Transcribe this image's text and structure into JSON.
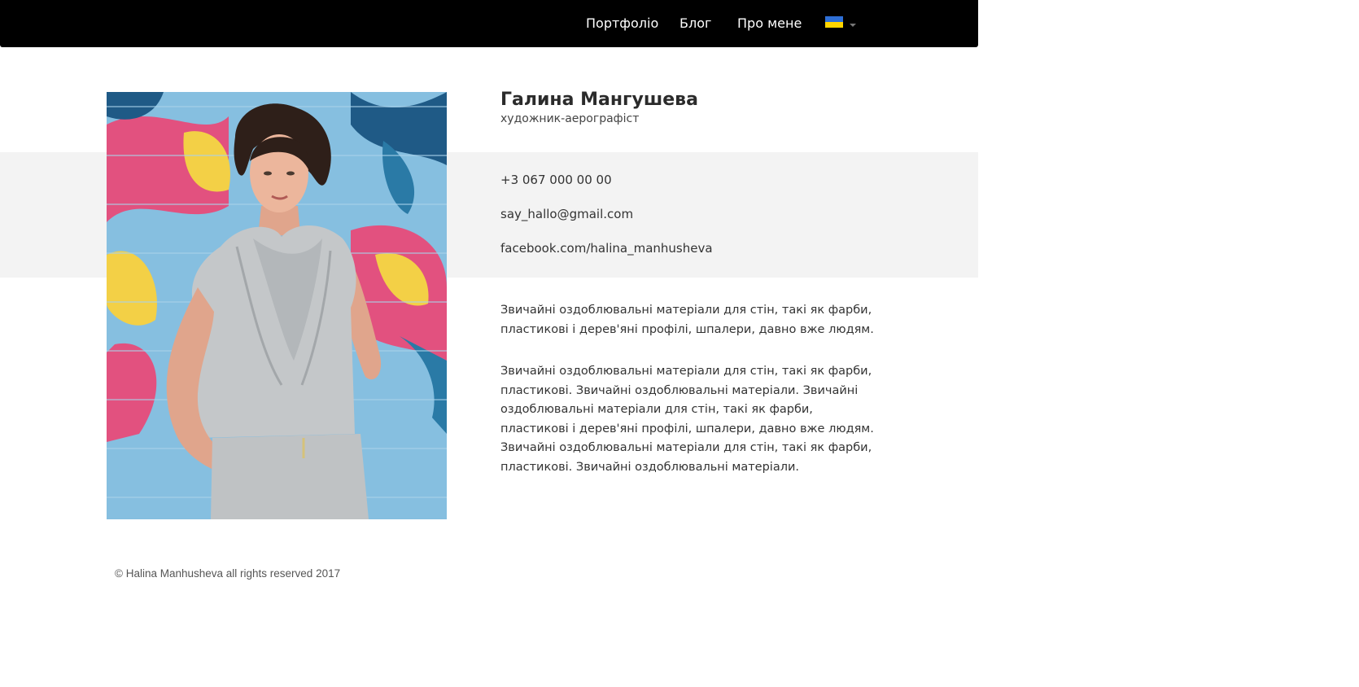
{
  "nav": {
    "items": [
      {
        "label": "Портфоліо"
      },
      {
        "label": "Блог"
      },
      {
        "label": "Про мене"
      }
    ],
    "language": {
      "flag_colors": [
        "#2e6fd6",
        "#ffd500"
      ]
    }
  },
  "profile": {
    "name": "Галина Мангушева",
    "title": "художник-аерографіст"
  },
  "contacts": {
    "phone": "+3 067 000 00 00",
    "email": "say_hallo@gmail.com",
    "facebook": "facebook.com/halina_manhusheva"
  },
  "about": {
    "paragraph1": "Звичайні оздоблювальні матеріали для стін, такі як фарби, пластикові і дерев'яні профілі, шпалери, давно вже людям.",
    "paragraph2": "Звичайні оздоблювальні матеріали для стін, такі як фарби, пластикові. Звичайні оздоблювальні матеріали. Звичайні оздоблювальні матеріали для стін, такі як фарби, пластикові і дерев'яні профілі, шпалери, давно вже людям. Звичайні оздоблювальні матеріали для стін, такі як фарби, пластикові. Звичайні оздоблювальні матеріали."
  },
  "footer": {
    "copyright": "© Halina Manhusheva all rights reserved 2017"
  },
  "colors": {
    "navbar_bg": "#000000",
    "band_bg": "#f3f3f3"
  }
}
